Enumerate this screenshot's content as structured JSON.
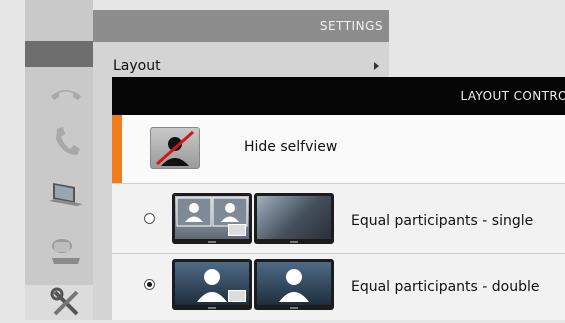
{
  "settings": {
    "title": "SETTINGS",
    "items": [
      {
        "label": "Layout"
      }
    ]
  },
  "rail": {
    "icons": [
      "phone-hangup-icon",
      "phone-icon",
      "laptop-icon",
      "camera-icon",
      "tools-icon"
    ]
  },
  "layout_control": {
    "title": "LAYOUT CONTROL",
    "selfview": {
      "label": "Hide selfview",
      "accent": "#f27c1c"
    },
    "options": [
      {
        "label": "Equal participants - single",
        "selected": false
      },
      {
        "label": "Equal participants - double",
        "selected": true
      }
    ]
  }
}
